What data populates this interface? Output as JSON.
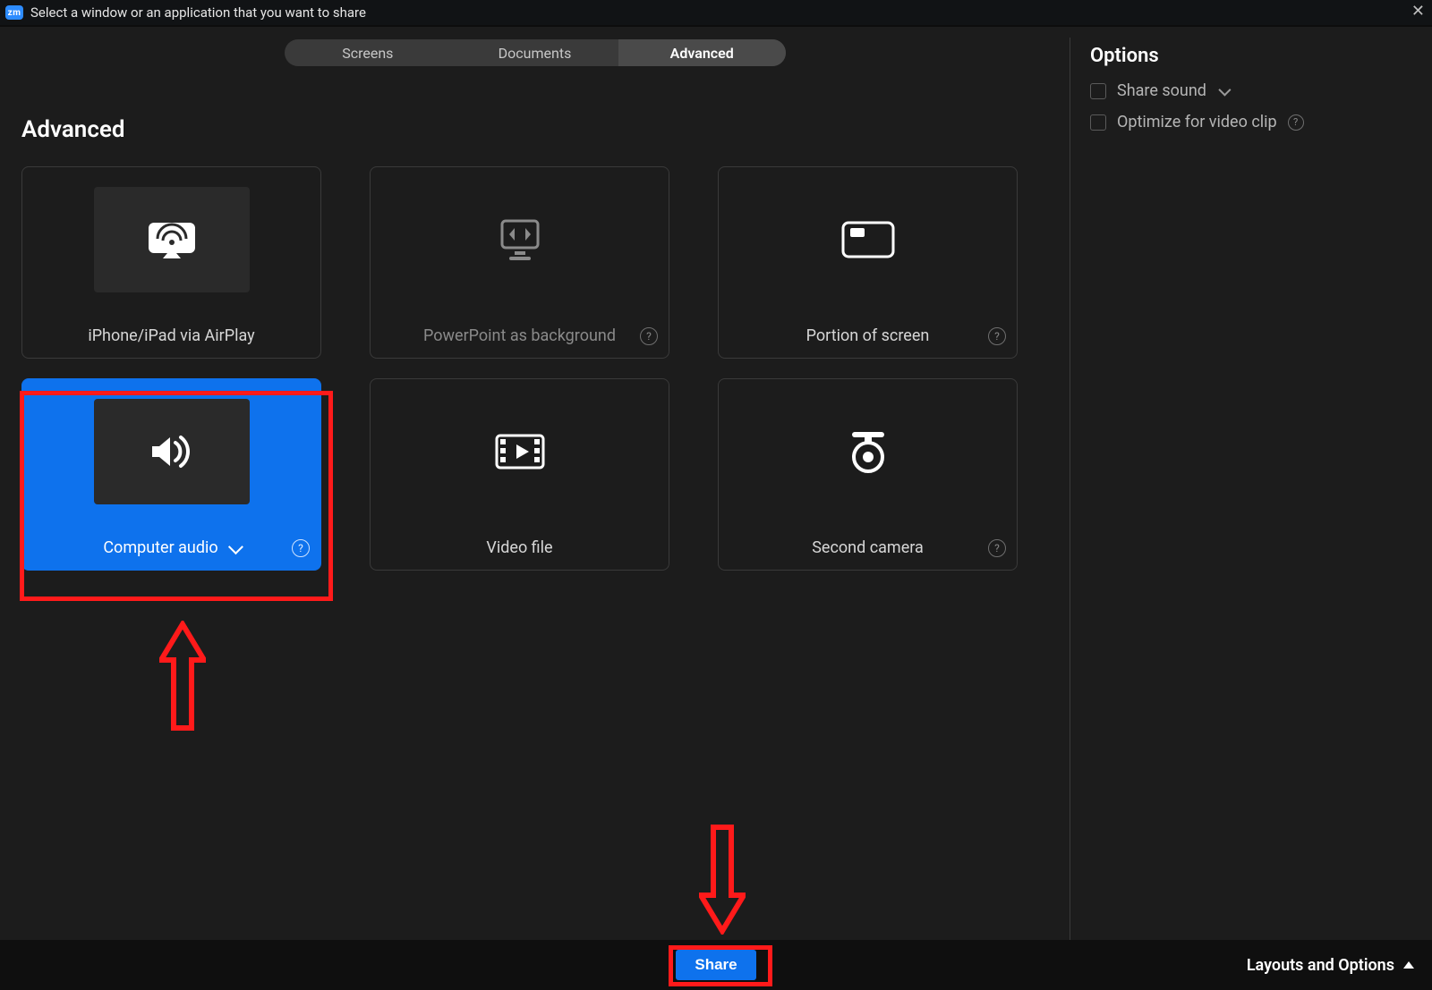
{
  "titlebar": {
    "logo_text": "zm",
    "title": "Select a window or an application that you want to share"
  },
  "tabs": {
    "items": [
      {
        "label": "Screens",
        "active": false
      },
      {
        "label": "Documents",
        "active": false
      },
      {
        "label": "Advanced",
        "active": true
      }
    ]
  },
  "section_title": "Advanced",
  "cards": {
    "airplay": {
      "label": "iPhone/iPad via AirPlay"
    },
    "pptbg": {
      "label": "PowerPoint as background"
    },
    "portion": {
      "label": "Portion of screen"
    },
    "audio": {
      "label": "Computer audio"
    },
    "video": {
      "label": "Video file"
    },
    "camera": {
      "label": "Second camera"
    }
  },
  "options": {
    "heading": "Options",
    "share_sound_label": "Share sound",
    "optimize_label": "Optimize for video clip"
  },
  "footer": {
    "share_label": "Share",
    "layouts_label": "Layouts and Options"
  },
  "colors": {
    "accent": "#0e72ed",
    "annotation": "#ff1a1a"
  }
}
